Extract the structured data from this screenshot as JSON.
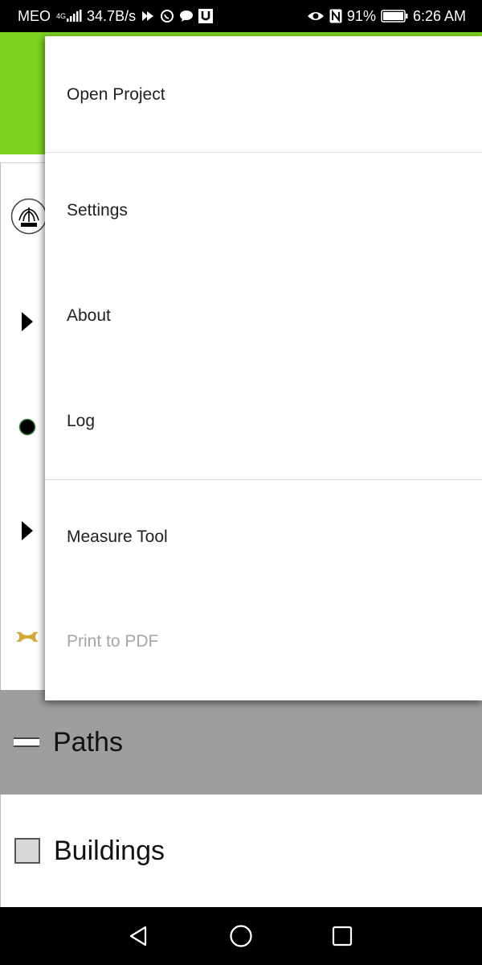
{
  "status_bar": {
    "carrier": "MEO",
    "network_type": "4G",
    "speed": "34.7B/s",
    "battery": "91%",
    "time": "6:26 AM",
    "icons_left": [
      "signal-icon",
      "data-arrow-icon",
      "whatsapp-icon",
      "chat-bubble-icon",
      "u-app-icon"
    ],
    "icons_right": [
      "eye-icon",
      "nfc-icon",
      "battery-icon"
    ]
  },
  "app": {
    "toolbar_color": "#7ed321",
    "layer_icons": [
      "fountain-icon",
      "play-arrow-icon",
      "dot-icon",
      "play-arrow-icon",
      "bone-icon"
    ],
    "rows": [
      {
        "label": "Paths",
        "swatch": "paths-swatch",
        "background": "#9e9e9e"
      },
      {
        "label": "Buildings",
        "swatch": "buildings-swatch",
        "background": "#ffffff"
      }
    ]
  },
  "drawer": {
    "items": [
      {
        "label": "Open Project",
        "enabled": true
      },
      {
        "label": "Settings",
        "enabled": true
      },
      {
        "label": "About",
        "enabled": true
      },
      {
        "label": "Log",
        "enabled": true
      },
      {
        "label": "Measure Tool",
        "enabled": true
      },
      {
        "label": "Print to PDF",
        "enabled": false
      }
    ]
  },
  "nav_bar": {
    "buttons": [
      "back-icon",
      "home-icon",
      "recents-icon"
    ]
  }
}
